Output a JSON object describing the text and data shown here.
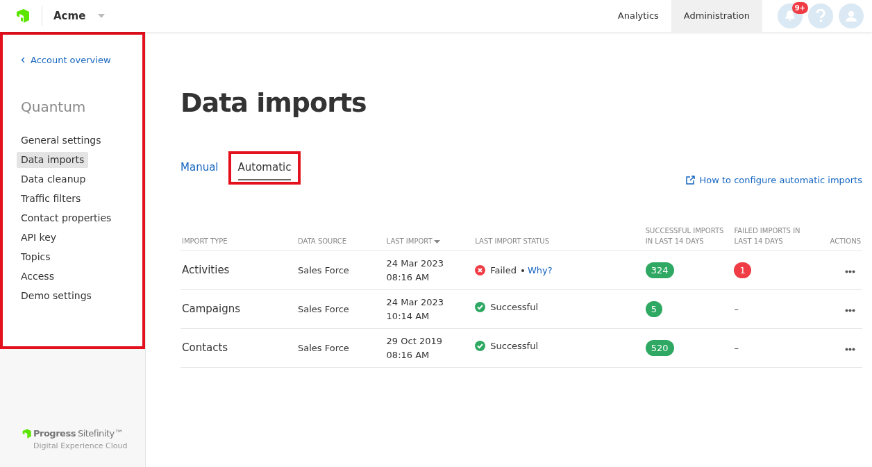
{
  "topbar": {
    "site": "Acme",
    "nav": [
      {
        "label": "Analytics",
        "selected": false
      },
      {
        "label": "Administration",
        "selected": true
      }
    ],
    "notification_count": "9+"
  },
  "sidebar": {
    "back_link": "Account overview",
    "title": "Quantum",
    "highlighted": true,
    "items": [
      {
        "label": "General settings",
        "selected": false
      },
      {
        "label": "Data imports",
        "selected": true
      },
      {
        "label": "Data cleanup",
        "selected": false
      },
      {
        "label": "Traffic filters",
        "selected": false
      },
      {
        "label": "Contact properties",
        "selected": false
      },
      {
        "label": "API key",
        "selected": false
      },
      {
        "label": "Topics",
        "selected": false
      },
      {
        "label": "Access",
        "selected": false
      },
      {
        "label": "Demo settings",
        "selected": false
      }
    ],
    "footer_logo": {
      "brand": "Progress",
      "product": "Sitefinity™",
      "tagline": "Digital Experience Cloud"
    }
  },
  "page": {
    "title": "Data imports",
    "tabs": [
      {
        "label": "Manual",
        "selected": false,
        "highlighted": false
      },
      {
        "label": "Automatic",
        "selected": true,
        "highlighted": true
      }
    ],
    "help_link": "How to configure automatic imports",
    "table": {
      "columns": [
        {
          "label": "IMPORT TYPE"
        },
        {
          "label": "DATA SOURCE"
        },
        {
          "label": "LAST IMPORT",
          "sorted": true
        },
        {
          "label": "LAST IMPORT STATUS"
        },
        {
          "label": "SUCCESSFUL IMPORTS IN LAST 14 DAYS"
        },
        {
          "label": "FAILED IMPORTS IN LAST 14 DAYS"
        },
        {
          "label": "ACTIONS"
        }
      ],
      "rows": [
        {
          "type": "Activities",
          "source": "Sales Force",
          "date": "24 Mar 2023",
          "time": "08:16 AM",
          "kind": "failed",
          "status_label": "Failed",
          "detail_link": "Why?",
          "successful": "324",
          "failed": "1"
        },
        {
          "type": "Campaigns",
          "source": "Sales Force",
          "date": "24 Mar 2023",
          "time": "10:14 AM",
          "kind": "successful",
          "status_label": "Successful",
          "successful": "5",
          "failed": "–"
        },
        {
          "type": "Contacts",
          "source": "Sales Force",
          "date": "29 Oct 2019",
          "time": "08:16 AM",
          "kind": "successful",
          "status_label": "Successful",
          "successful": "520",
          "failed": "–"
        }
      ]
    }
  }
}
